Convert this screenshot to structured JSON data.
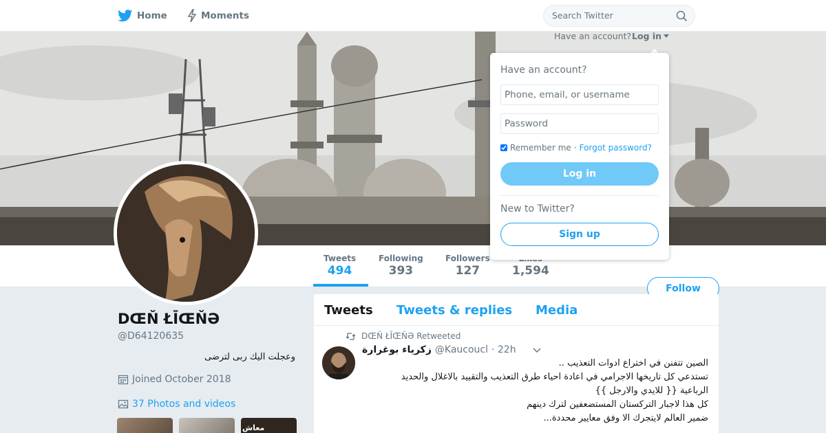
{
  "nav": {
    "home_label": "Home",
    "moments_label": "Moments",
    "search_placeholder": "Search Twitter"
  },
  "profile": {
    "name": "DŒŇ ŁĪŒŇƏ",
    "handle": "@D64120635",
    "bio": "وعجلت اليك ربى لترضى",
    "joined": "Joined October 2018",
    "photos_link": "37 Photos and videos"
  },
  "stats": [
    {
      "label": "Tweets",
      "value": "494"
    },
    {
      "label": "Following",
      "value": "393"
    },
    {
      "label": "Followers",
      "value": "127"
    },
    {
      "label": "Likes",
      "value": "1,594"
    }
  ],
  "follow_label": "Follow",
  "timeline": {
    "tabs": [
      "Tweets",
      "Tweets & replies",
      "Media"
    ],
    "retweet_label": "DŒŇ ŁĪŒŇƏ Retweeted",
    "tweet": {
      "author_name": "زكرياء بوغرارة",
      "author_handle": "@Kaucoucl",
      "time": "· 22h",
      "lines": [
        "الصين تتفنن في اختراع ادوات التعذيب ..",
        "تستدعي كل تاريخها الاجرامي في  اعادة احياء طرق التعذيب والتقييد بالاغلال والحديد",
        "الرباعية {{ للايدي والارجل }}",
        "كل هذا لاجبار التركستان المستضعفين لترك دينهم",
        "ضمير العالم لايتجرك الا  وفق معايير محددة..."
      ]
    }
  },
  "login": {
    "have_account_short": "Have an account?",
    "login_link": "Log in",
    "title": "Have an account?",
    "username_placeholder": "Phone, email, or username",
    "password_placeholder": "Password",
    "remember_label": "Remember me",
    "separator": "·",
    "forgot_label": "Forgot password?",
    "login_button": "Log in",
    "new_label": "New to Twitter?",
    "signup_button": "Sign up"
  },
  "thumb_caption": "معاش",
  "colors": {
    "brand": "#1da1f2",
    "login_button": "#71c9f8",
    "background": "#e6ecf0"
  }
}
